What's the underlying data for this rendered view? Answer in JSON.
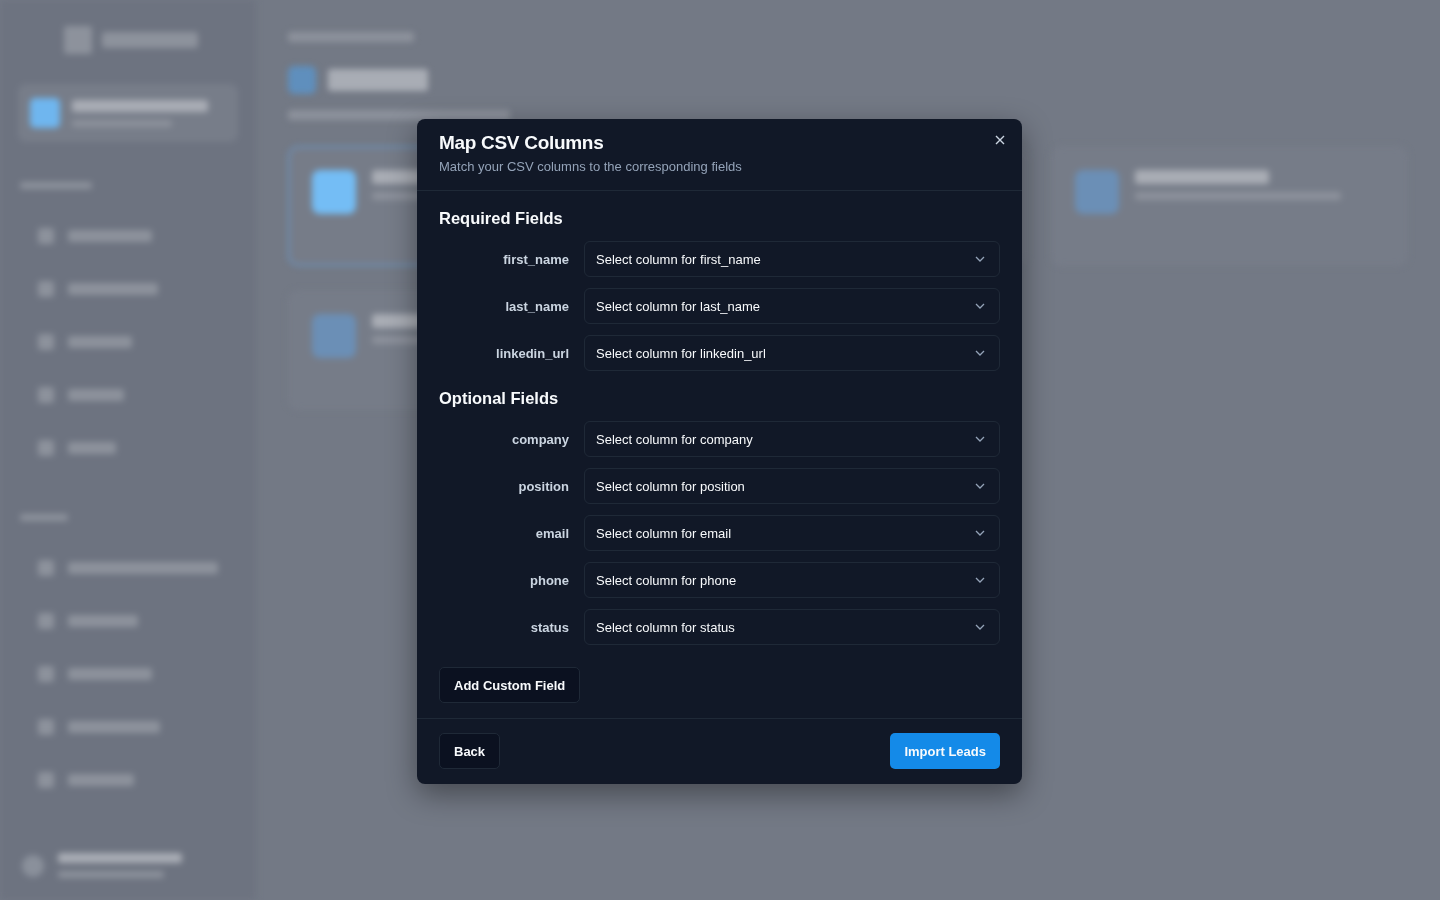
{
  "dialog": {
    "title": "Map CSV Columns",
    "subtitle": "Match your CSV columns to the corresponding fields",
    "sections": [
      {
        "title": "Required Fields",
        "fields": [
          {
            "label": "first_name",
            "placeholder": "Select column for first_name"
          },
          {
            "label": "last_name",
            "placeholder": "Select column for last_name"
          },
          {
            "label": "linkedin_url",
            "placeholder": "Select column for linkedin_url"
          }
        ]
      },
      {
        "title": "Optional Fields",
        "fields": [
          {
            "label": "company",
            "placeholder": "Select column for company"
          },
          {
            "label": "position",
            "placeholder": "Select column for position"
          },
          {
            "label": "email",
            "placeholder": "Select column for email"
          },
          {
            "label": "phone",
            "placeholder": "Select column for phone"
          },
          {
            "label": "status",
            "placeholder": "Select column for status"
          }
        ]
      }
    ],
    "add_button": "Add Custom Field",
    "back_button": "Back",
    "import_button": "Import Leads"
  }
}
